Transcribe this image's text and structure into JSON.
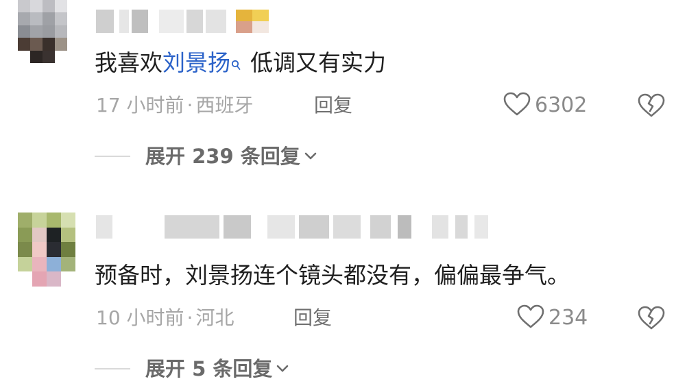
{
  "comments": [
    {
      "text_prefix": "我喜欢",
      "keyword": "刘景扬",
      "text_suffix": "低调又有实力",
      "time": "17 小时前",
      "separator": "·",
      "location": "西班牙",
      "reply_label": "回复",
      "like_count": "6302",
      "expand_label": "展开 239 条回复"
    },
    {
      "text": "预备时，刘景扬连个镜头都没有，偏偏最争气。",
      "time": "10 小时前",
      "separator": "·",
      "location": "河北",
      "reply_label": "回复",
      "like_count": "234",
      "expand_label": "展开 5 条回复"
    }
  ],
  "colors": {
    "keyword": "#2c63c9",
    "meta": "#a6a6a6",
    "body_text": "#1f1f1f",
    "icon": "#6f6f6f"
  },
  "icons": [
    "search-icon",
    "heart-icon",
    "broken-heart-icon",
    "chevron-down-icon"
  ]
}
